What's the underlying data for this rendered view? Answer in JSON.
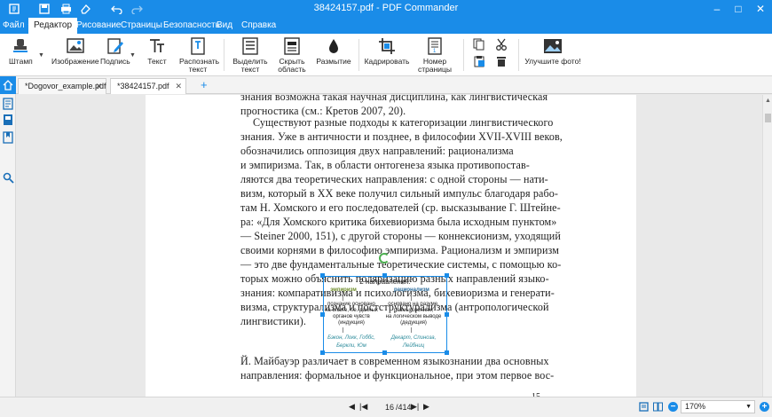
{
  "app": {
    "title": "38424157.pdf - PDF Commander",
    "accent": "#1a8ce8"
  },
  "window_controls": {
    "minimize": "–",
    "maximize": "□",
    "close": "✕"
  },
  "ribbon_tabs": [
    {
      "label": "Файл"
    },
    {
      "label": "Редактор"
    },
    {
      "label": "Рисование"
    },
    {
      "label": "Страницы"
    },
    {
      "label": "Безопасность"
    },
    {
      "label": "Вид"
    },
    {
      "label": "Справка"
    }
  ],
  "ribbon": {
    "stamp": "Штамп",
    "image": "Изображение",
    "signature": "Подпись",
    "text": "Текст",
    "recognize": "Распознать текст",
    "highlight": "Выделить текст",
    "hide_area": "Скрыть область",
    "blur": "Размытие",
    "crop": "Кадрировать",
    "page_number": "Номер страницы",
    "best_photo": "Улучшите фото!"
  },
  "doc_tabs": [
    {
      "label": "*Dogovor_example.pdf",
      "close": "✕"
    },
    {
      "label": "*38424157.pdf",
      "close": "✕"
    }
  ],
  "add_tab": "+",
  "document": {
    "lines": [
      "знания возможна такая научная дисциплина, как лингвистическая",
      "прогностика (см.: Кретов 2007, 20).",
      "Существуют разные подходы к категоризации лингвистического",
      "знания. Уже в античности и позднее, в философии XVII-XVIII веков,",
      "обозначились оппозиция двух направлений: рационализма",
      "и эмпиризма. Так, в области онтогенеза языка противопостав-",
      "ляются два теоретических направления: с одной стороны — нати-",
      "визм, который в XX веке получил сильный импульс благодаря рабо-",
      "там Н. Хомского и его последователей (ср. высказывание Г. Штейне-",
      "ра: «Для Хомского критика бихевиоризма была исходным пунктом»",
      "— Steiner 2000, 151), с другой стороны — коннексионизм, уходящий",
      "своими корнями в философию эмпиризма. Рационализм и эмпиризм",
      "— это две фундаментальные теоретические системы, с помощью ко-",
      "торых можно объяснить поляризацию разных направлений языко-",
      "знания: компаративизма и психологизма, бихевиоризма и генерати-",
      "визма, структурализма и постструктурализма (антропологической",
      "лингвистики)."
    ],
    "lines_after": [
      "Й. Майбауэр различает в современном языкознании два основных",
      "направления: формальное и функциональное, при этом первое вос-"
    ],
    "page_number": "15"
  },
  "figure": {
    "title": "2 направления:",
    "left_head": "эмпиризм",
    "right_head": "рационализм",
    "left_body": [
      "познание основано",
      "на опыте, т.е. данных",
      "органов чувств",
      "(индукция)"
    ],
    "right_body": [
      "основано на разуме,",
      "размышлениях,",
      "на логическом выводе",
      "(дедукция)"
    ],
    "left_names": [
      "Бэкон, Локк, Гоббс,",
      "Беркли, Юм"
    ],
    "right_names": [
      "Декарт, Спиноза,",
      "Лейбниц"
    ]
  },
  "status": {
    "current_page": "16",
    "total_pages": "/414",
    "zoom": "170%",
    "zoom_out": "−",
    "zoom_in": "+"
  }
}
